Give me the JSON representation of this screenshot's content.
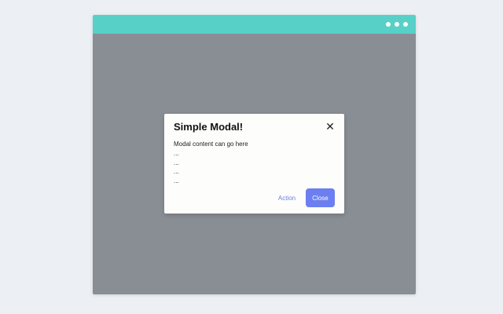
{
  "modal": {
    "title": "Simple Modal!",
    "close_icon": "✕",
    "body_lines": [
      "Modal content can go here",
      "...",
      "...",
      "...",
      "..."
    ],
    "action_label": "Action",
    "close_label": "Close"
  },
  "colors": {
    "titlebar": "#57d0c8",
    "overlay": "#898e94",
    "accent": "#6c7ff0",
    "background": "#eceff3"
  },
  "icons": {
    "window_menu": "more-dots-icon",
    "modal_close": "close-icon"
  }
}
